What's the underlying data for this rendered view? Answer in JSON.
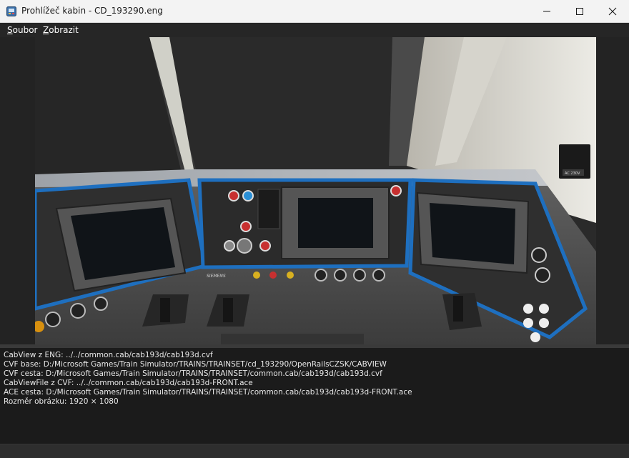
{
  "window": {
    "title": "Prohlížeč kabin - CD_193290.eng"
  },
  "menu": {
    "items": [
      {
        "mnemonic": "S",
        "rest": "oubor"
      },
      {
        "mnemonic": "Z",
        "rest": "obrazit"
      }
    ]
  },
  "cab_image": {
    "brand_text": "SIEMENS",
    "socket_label": "AC 230V",
    "accent_color": "#1e6fbf"
  },
  "info": {
    "lines": [
      "CabView z ENG: ../../common.cab/cab193d/cab193d.cvf",
      "CVF base: D:/Microsoft Games/Train Simulator/TRAINS/TRAINSET/cd_193290/OpenRailsCZSK/CABVIEW",
      "CVF cesta: D:/Microsoft Games/Train Simulator/TRAINS/TRAINSET/common.cab/cab193d/cab193d.cvf",
      "CabViewFile z CVF: ../../common.cab/cab193d/cab193d-FRONT.ace",
      "ACE cesta: D:/Microsoft Games/Train Simulator/TRAINS/TRAINSET/common.cab/cab193d/cab193d-FRONT.ace",
      "Rozměr obrázku: 1920 × 1080"
    ]
  }
}
